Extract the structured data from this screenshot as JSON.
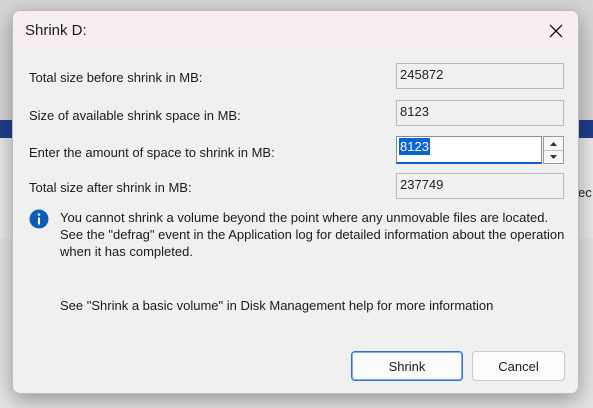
{
  "background": {
    "partial_text": "ec"
  },
  "dialog": {
    "title": "Shrink D:",
    "close_icon": "close-icon",
    "rows": [
      {
        "label": "Total size before shrink in MB:",
        "value": "245872"
      },
      {
        "label": "Size of available shrink space in MB:",
        "value": "8123"
      },
      {
        "label": "Enter the amount of space to shrink in MB:",
        "value": "8123"
      },
      {
        "label": "Total size after shrink in MB:",
        "value": "237749"
      }
    ],
    "info_icon": "info-icon",
    "info_text": "You cannot shrink a volume beyond the point where any unmovable files are located. See the \"defrag\" event in the Application log for detailed information about the operation when it has completed.",
    "help_text": "See \"Shrink a basic volume\" in Disk Management help for more information",
    "buttons": {
      "shrink": "Shrink",
      "cancel": "Cancel"
    }
  },
  "colors": {
    "accent": "#0a64d8",
    "info_blue": "#0b5cbd",
    "title_bar": "#f7eef3"
  }
}
